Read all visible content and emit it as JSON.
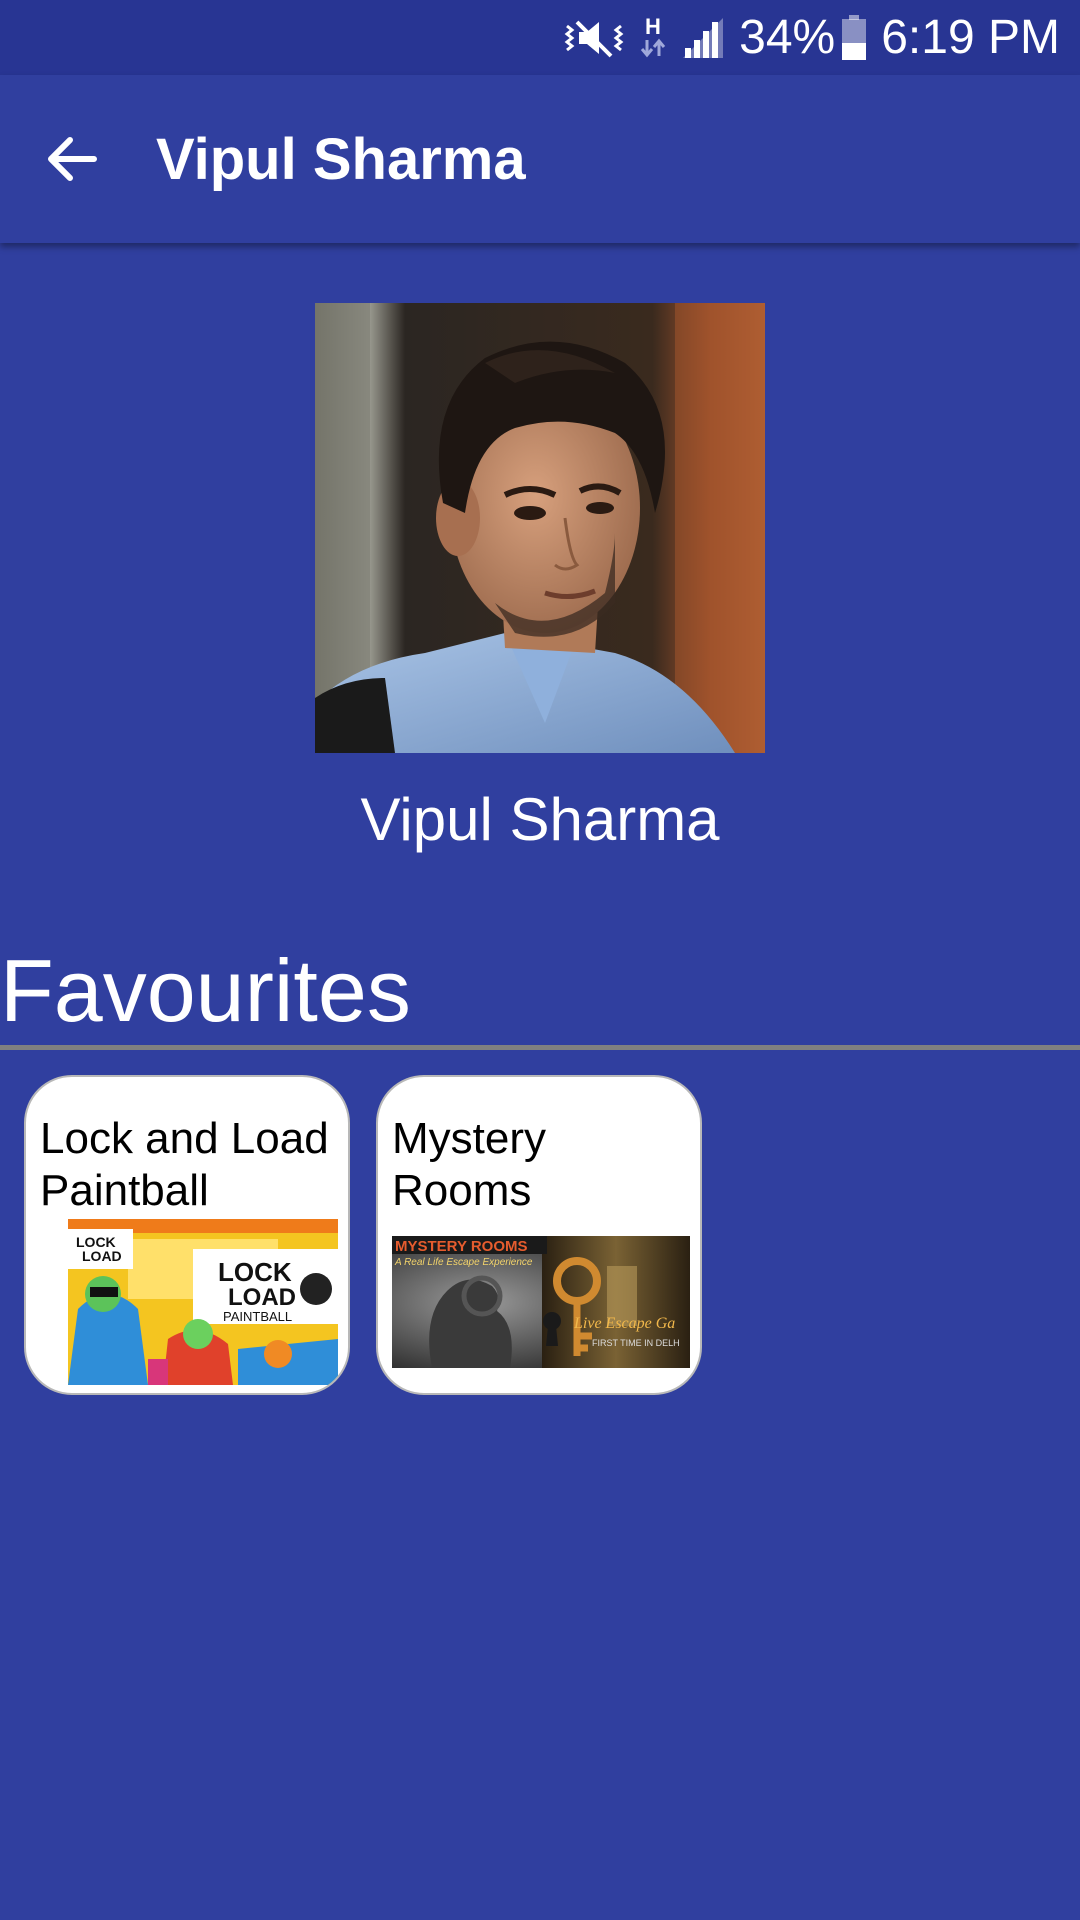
{
  "status_bar": {
    "network_type": "H",
    "battery_percent": "34%",
    "time": "6:19 PM",
    "icons": [
      "vibrate-mute-icon",
      "data-activity-icon",
      "signal-icon",
      "battery-icon"
    ]
  },
  "app_bar": {
    "title": "Vipul Sharma",
    "back_icon": "arrow-back-icon"
  },
  "profile": {
    "name": "Vipul Sharma"
  },
  "favourites": {
    "title": "Favourites",
    "items": [
      {
        "title": "Lock and Load Paintball",
        "image_text": [
          "LOCK",
          "LOAD",
          "PAINTBALL"
        ]
      },
      {
        "title": "Mystery Rooms",
        "image_text": [
          "MYSTERY ROOMS",
          "A Real Life Escape Experience",
          "Live Escape Ga",
          "FIRST TIME IN DELH"
        ]
      }
    ]
  },
  "colors": {
    "primary": "#303f9f",
    "primary_dark": "#283593",
    "card_bg": "#ffffff",
    "divider": "#808080"
  }
}
